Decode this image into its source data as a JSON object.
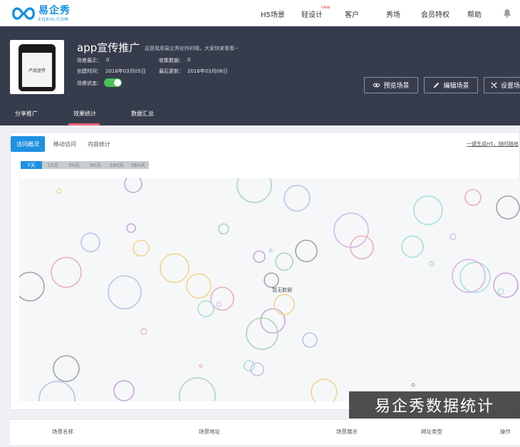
{
  "logo": {
    "cn": "易企秀",
    "en": "EQXIU.COM"
  },
  "nav": {
    "items": [
      {
        "label": "H5场景",
        "badge": ""
      },
      {
        "label": "轻设计",
        "badge": "new"
      },
      {
        "label": "客户",
        "badge": ""
      },
      {
        "label": "秀场",
        "badge": ""
      },
      {
        "label": "会员特权",
        "badge": ""
      },
      {
        "label": "帮助",
        "badge": ""
      }
    ]
  },
  "scene": {
    "thumbnail_text": "产品宣传",
    "title": "app宣传推广",
    "description": "这是我用易企秀创作的哦，大家快来看看~",
    "views_label": "场景展示：",
    "views_value": "0",
    "collected_label": "收集数据：",
    "collected_value": "0",
    "created_label": "创建时间：",
    "created_value": "2016年03月05日",
    "updated_label": "最后更新：",
    "updated_value": "2016年03月08日",
    "status_label": "场景状态：",
    "status_on": true
  },
  "actions": {
    "preview": "预览场景",
    "edit": "编辑场景",
    "settings": "设置场"
  },
  "header_tabs": [
    {
      "label": "分享推广",
      "active": false
    },
    {
      "label": "效果统计",
      "active": true
    },
    {
      "label": "数据汇总",
      "active": false
    }
  ],
  "panel": {
    "tabs": [
      {
        "label": "访问概况",
        "active": true
      },
      {
        "label": "移动访问",
        "active": false
      },
      {
        "label": "内容统计",
        "active": false
      }
    ],
    "link_text": "一键生成H5，随时随地",
    "ranges": [
      {
        "label": "7天",
        "active": true
      },
      {
        "label": "15天",
        "active": false
      },
      {
        "label": "30天",
        "active": false
      },
      {
        "label": "90天",
        "active": false
      },
      {
        "label": "180天",
        "active": false
      },
      {
        "label": "360天",
        "active": false
      }
    ],
    "empty_text": "暂无数据"
  },
  "table": {
    "columns": [
      "场景名称",
      "场景地址",
      "场景展示",
      "网址类型",
      "操作"
    ]
  },
  "watermark": "易企秀数据统计",
  "colors": {
    "accent": "#1e90e0",
    "header_bg": "#363c4c",
    "tab_underline": "#f2627b",
    "toggle_on": "#47c25b"
  }
}
